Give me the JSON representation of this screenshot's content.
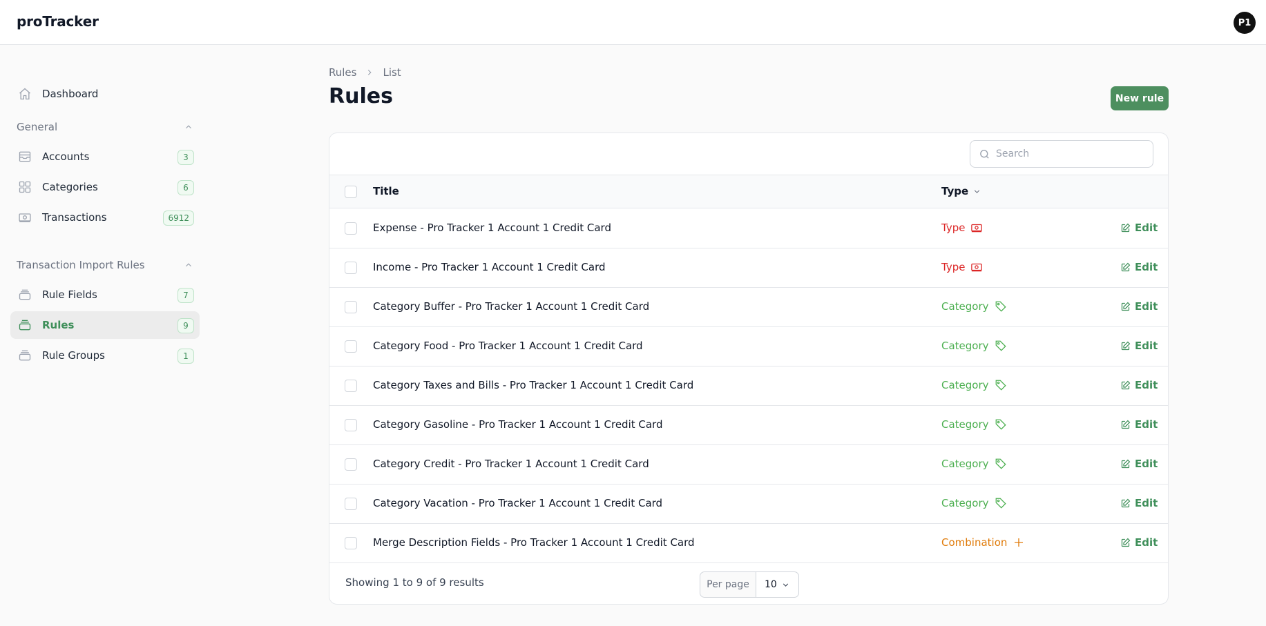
{
  "app": {
    "brand": "proTracker",
    "avatar_initials": "P1"
  },
  "sidebar": {
    "dashboard": {
      "label": "Dashboard",
      "icon": "home-icon"
    },
    "groups": [
      {
        "title": "General",
        "items": [
          {
            "label": "Accounts",
            "count": "3",
            "icon": "inbox-icon"
          },
          {
            "label": "Categories",
            "count": "6",
            "icon": "grid-icon"
          },
          {
            "label": "Transactions",
            "count": "6912",
            "icon": "banknote-icon"
          }
        ]
      },
      {
        "title": "Transaction Import Rules",
        "items": [
          {
            "label": "Rule Fields",
            "count": "7",
            "icon": "stack-icon"
          },
          {
            "label": "Rules",
            "count": "9",
            "icon": "stack-icon",
            "active": true
          },
          {
            "label": "Rule Groups",
            "count": "1",
            "icon": "stack-icon"
          }
        ]
      }
    ]
  },
  "breadcrumb": {
    "items": [
      "Rules",
      "List"
    ]
  },
  "page": {
    "title": "Rules",
    "new_button": "New rule"
  },
  "search": {
    "placeholder": "Search",
    "value": ""
  },
  "table": {
    "columns": {
      "title": "Title",
      "type": "Type"
    },
    "edit_label": "Edit",
    "rows": [
      {
        "title": "Expense - Pro Tracker 1 Account 1 Credit Card",
        "type": "Type",
        "type_icon": "banknote-icon",
        "type_color": "#dc2626"
      },
      {
        "title": "Income - Pro Tracker 1 Account 1 Credit Card",
        "type": "Type",
        "type_icon": "banknote-icon",
        "type_color": "#dc2626"
      },
      {
        "title": "Category Buffer - Pro Tracker 1 Account 1 Credit Card",
        "type": "Category",
        "type_icon": "tag-icon",
        "type_color": "#4caf50"
      },
      {
        "title": "Category Food - Pro Tracker 1 Account 1 Credit Card",
        "type": "Category",
        "type_icon": "tag-icon",
        "type_color": "#4caf50"
      },
      {
        "title": "Category Taxes and Bills - Pro Tracker 1 Account 1 Credit Card",
        "type": "Category",
        "type_icon": "tag-icon",
        "type_color": "#4caf50"
      },
      {
        "title": "Category Gasoline - Pro Tracker 1 Account 1 Credit Card",
        "type": "Category",
        "type_icon": "tag-icon",
        "type_color": "#4caf50"
      },
      {
        "title": "Category Credit - Pro Tracker 1 Account 1 Credit Card",
        "type": "Category",
        "type_icon": "tag-icon",
        "type_color": "#4caf50"
      },
      {
        "title": "Category Vacation - Pro Tracker 1 Account 1 Credit Card",
        "type": "Category",
        "type_icon": "tag-icon",
        "type_color": "#4caf50"
      },
      {
        "title": "Merge Description Fields - Pro Tracker 1 Account 1 Credit Card",
        "type": "Combination",
        "type_icon": "plus-icon",
        "type_color": "#e07b0a"
      }
    ]
  },
  "pagination": {
    "summary": "Showing 1 to 9 of 9 results",
    "per_page_label": "Per page",
    "per_page_value": "10"
  },
  "colors": {
    "accent": "#4d8f5f",
    "active_text": "#3f8f5a",
    "type_red": "#dc2626",
    "category_green": "#4caf50",
    "combination_orange": "#e07b0a"
  }
}
